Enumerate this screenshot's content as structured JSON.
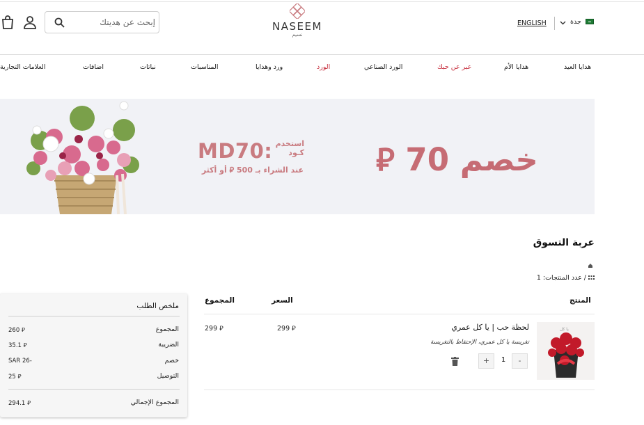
{
  "header": {
    "search_placeholder": "إبحث عن هديتك",
    "logo_text": "NASEEM",
    "logo_text_ar": "نسيم",
    "language_link": "ENGLISH",
    "city": "جدة"
  },
  "nav": [
    {
      "label": "هدايا العيد",
      "highlight": false
    },
    {
      "label": "هدايا الأم",
      "highlight": false
    },
    {
      "label": "عبر عن حبك",
      "highlight": true
    },
    {
      "label": "الورد الصناعي",
      "highlight": false
    },
    {
      "label": "الورد",
      "highlight": true
    },
    {
      "label": "ورد وهدايا",
      "highlight": false
    },
    {
      "label": "المناسبات",
      "highlight": false
    },
    {
      "label": "نباتات",
      "highlight": false
    },
    {
      "label": "اضافات",
      "highlight": false
    },
    {
      "label": "العلامات التجارية",
      "highlight": false
    }
  ],
  "banner": {
    "main": "خصم 70 ⃁",
    "code": "MD70:",
    "code_label_1": "استخدم",
    "code_label_2": "كـود",
    "condition": "عند الشراء بـ 500 ⃁ أو أكثر"
  },
  "cart": {
    "title": "عربة التسوق",
    "breadcrumb": "/ عدد المنتجات: 1",
    "columns": {
      "product": "المنتج",
      "price": "السعر",
      "total": "المجموع"
    },
    "items": [
      {
        "name": "لحظة حب | يا كل عمري",
        "note": "تغريسة يا كل عمري، الإحتفاظ بالتغريسة",
        "price": "299 ⃁",
        "total": "299 ⃁",
        "quantity": "1",
        "minus": "-",
        "plus": "+"
      }
    ]
  },
  "summary": {
    "title": "ملخص الطلب",
    "rows": [
      {
        "label": "المجموع",
        "value": "260 ⃁"
      },
      {
        "label": "الضريبة",
        "value": "35.1 ⃁"
      },
      {
        "label": "خصم",
        "value": "SAR 26-"
      },
      {
        "label": "التوصيل",
        "value": "25 ⃁"
      }
    ],
    "grand_total_label": "المجموع الإجمالي",
    "grand_total_value": "294.1 ⃁"
  },
  "colors": {
    "accent_red": "#c62d3c",
    "promo_pink": "#c66c74",
    "banner_bg": "#f1f2f6"
  }
}
